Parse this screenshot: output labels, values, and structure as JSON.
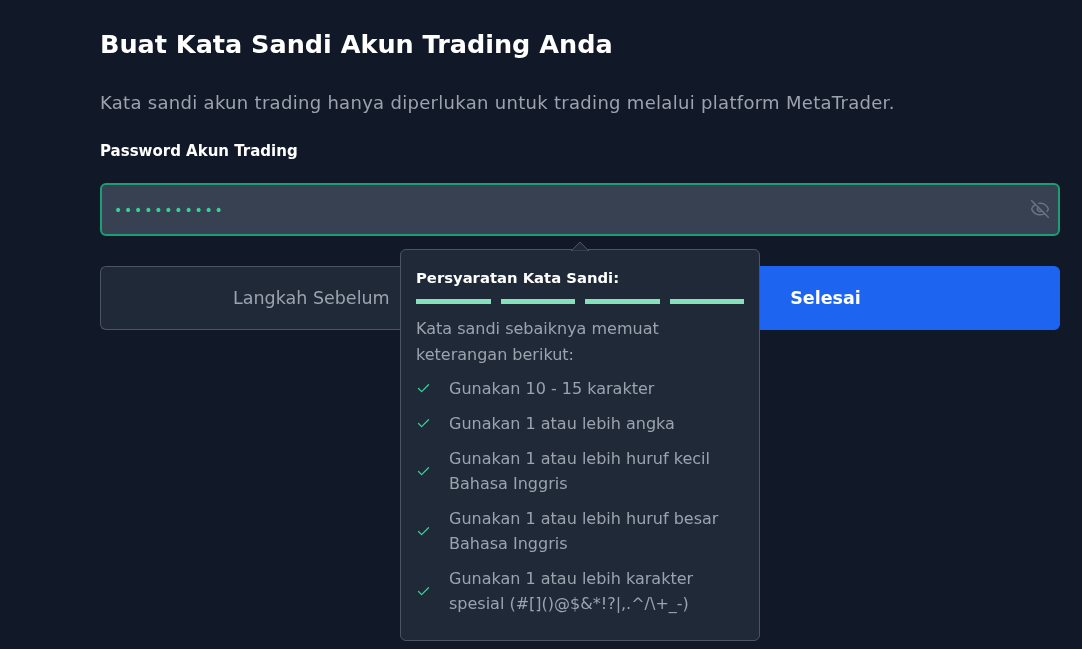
{
  "title": "Buat Kata Sandi Akun Trading Anda",
  "subtitle": "Kata sandi akun trading hanya diperlukan untuk trading melalui platform MetaTrader.",
  "password_field": {
    "label": "Password Akun Trading",
    "value": "•••••••••••",
    "focused": true,
    "visible": false
  },
  "buttons": [
    {
      "kind": "secondary",
      "label": "Langkah Sebelum"
    },
    {
      "kind": "primary",
      "label": "Selesai"
    }
  ],
  "requirements_popover": {
    "title": "Persyaratan Kata Sandi:",
    "strength_segments": [
      {
        "filled": true
      },
      {
        "filled": true
      },
      {
        "filled": true
      },
      {
        "filled": true
      }
    ],
    "intro": "Kata sandi sebaiknya memuat keterangan berikut:",
    "items": [
      {
        "text": "Gunakan 10 - 15 karakter",
        "met": true
      },
      {
        "text": "Gunakan 1 atau lebih angka",
        "met": true
      },
      {
        "text": "Gunakan 1 atau lebih huruf kecil Bahasa Inggris",
        "met": true
      },
      {
        "text": "Gunakan 1 atau lebih huruf besar Bahasa Inggris",
        "met": true
      },
      {
        "text": "Gunakan 1 atau lebih karakter spesial (#[]()@$&*!?|,.^/\\+_-)",
        "met": true
      }
    ]
  }
}
